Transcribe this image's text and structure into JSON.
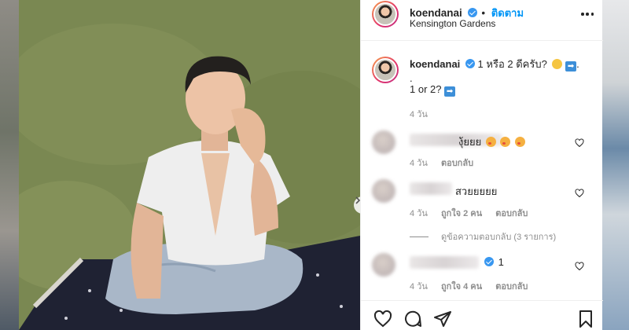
{
  "post": {
    "username": "koendanai",
    "follow_separator": "•",
    "follow_label": "ติดตาม",
    "location": "Kensington Gardens"
  },
  "caption": {
    "username": "koendanai",
    "line1": "1 หรือ 2 ดีครับ?",
    "line2": ".",
    "line3": "1 or 2?",
    "time": "4 วัน"
  },
  "comments": [
    {
      "text": "งุ้ยยย",
      "time": "4 วัน",
      "reply_label": "ตอบกลับ"
    },
    {
      "text": "สวยยยยย",
      "time": "4 วัน",
      "likes_label": "ถูกใจ 2 คน",
      "reply_label": "ตอบกลับ"
    },
    {
      "text": "1",
      "time": "4 วัน",
      "likes_label": "ถูกใจ 4 คน",
      "reply_label": "ตอบกลับ"
    }
  ],
  "view_replies_label": "ดูข้อความตอบกลับ (3 รายการ)",
  "icons": {
    "more": "more-horizontal-icon",
    "verified": "verified-badge-icon",
    "heart": "heart-icon",
    "comment": "comment-icon",
    "share": "share-icon",
    "save": "bookmark-icon",
    "carousel_next": "chevron-right-icon"
  },
  "colors": {
    "link_blue": "#0095f6",
    "verified_blue": "#3897f0",
    "muted_text": "#8e8e8e",
    "text": "#262626"
  }
}
